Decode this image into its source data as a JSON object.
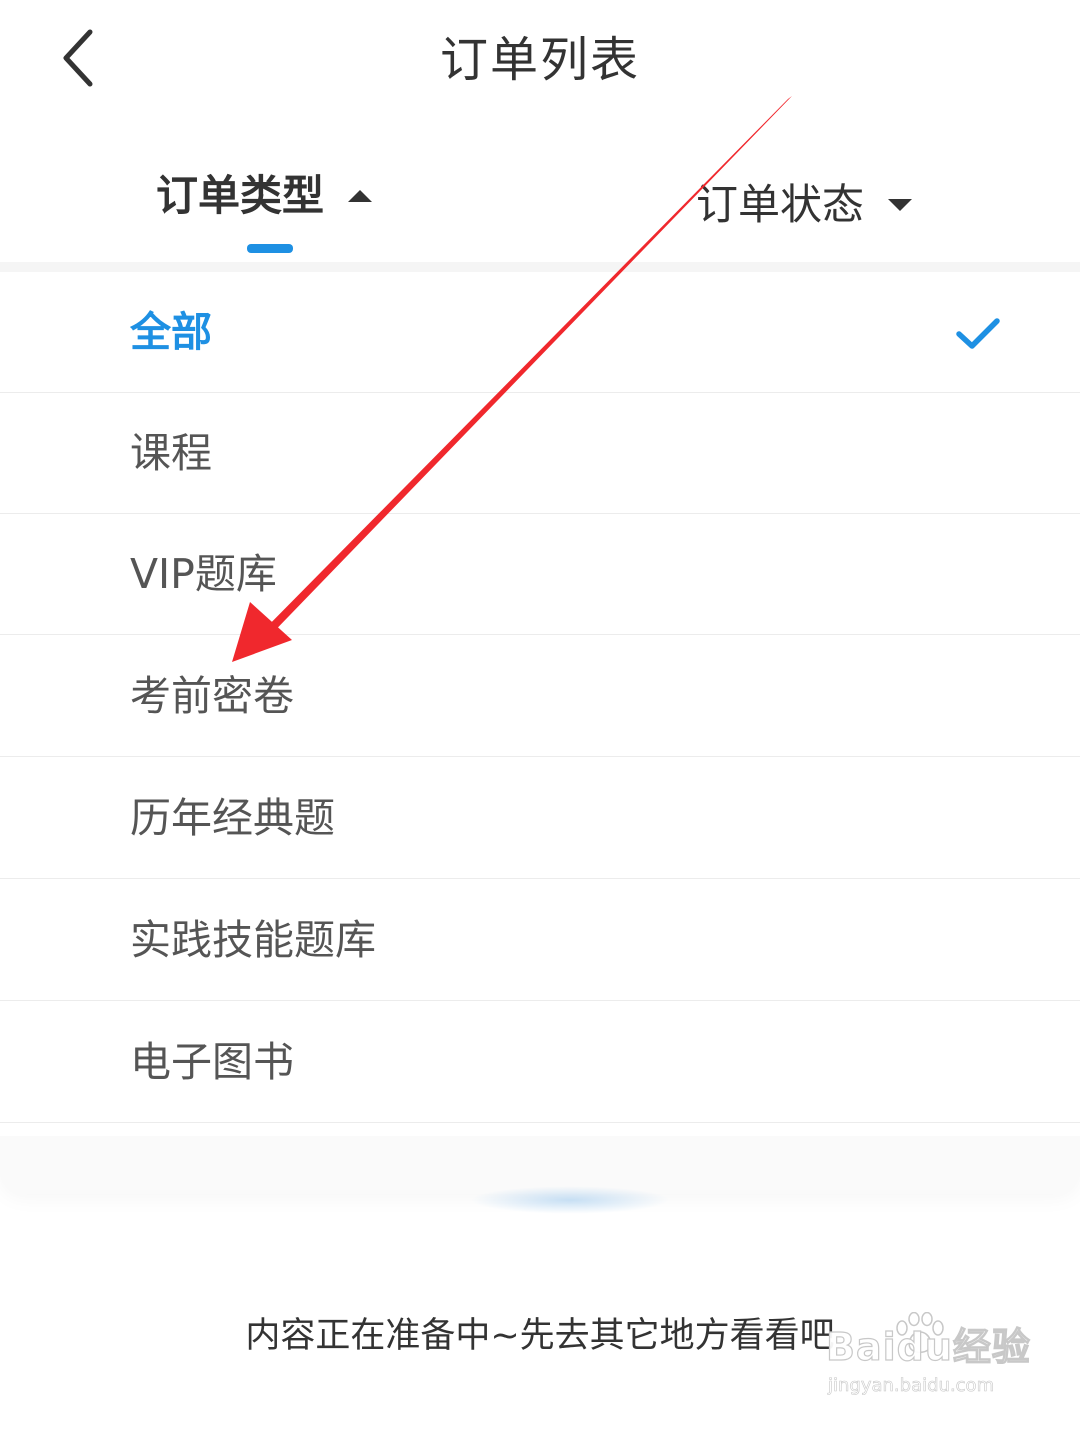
{
  "header": {
    "title": "订单列表",
    "back_icon": "chevron-left-icon"
  },
  "filters": {
    "type_label": "订单类型",
    "type_arrow": "caret-up-icon",
    "status_label": "订单状态",
    "status_arrow": "caret-down-icon",
    "active": "type",
    "accent_color": "#1e90e3"
  },
  "order_types": {
    "items": [
      {
        "label": "全部",
        "selected": true
      },
      {
        "label": "课程",
        "selected": false
      },
      {
        "label": "VIP题库",
        "selected": false
      },
      {
        "label": "考前密卷",
        "selected": false
      },
      {
        "label": "历年经典题",
        "selected": false
      },
      {
        "label": "实践技能题库",
        "selected": false
      },
      {
        "label": "电子图书",
        "selected": false
      }
    ],
    "check_icon": "checkmark-icon"
  },
  "empty_state": {
    "message": "内容正在准备中~先去其它地方看看吧"
  },
  "annotation": {
    "type": "red-arrow",
    "color": "#f0282d",
    "points_to": "考前密卷"
  },
  "watermark": {
    "brand": "Baidu经验",
    "url": "jingyan.baidu.com"
  }
}
